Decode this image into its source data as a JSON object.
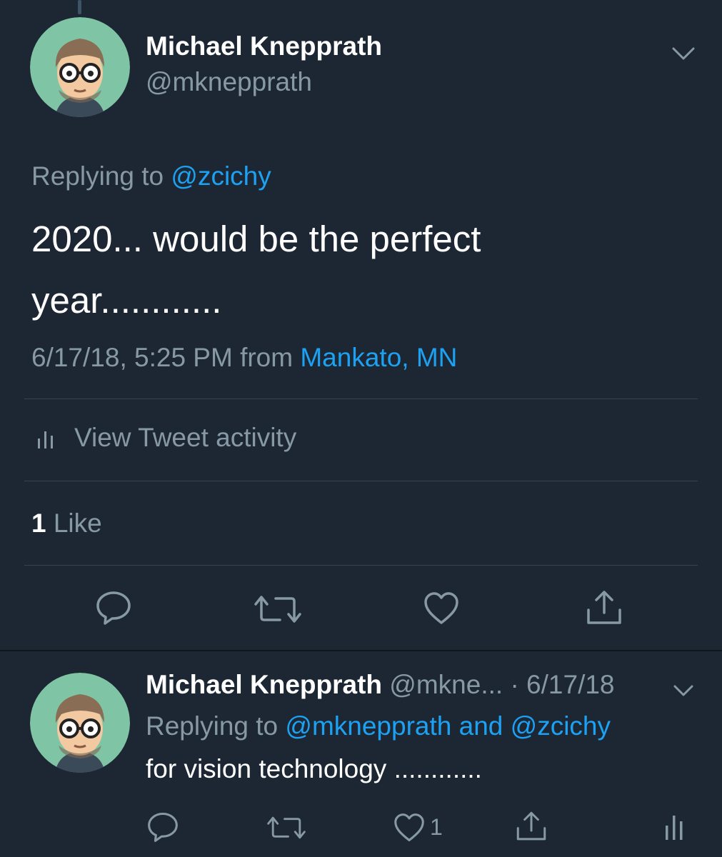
{
  "main_tweet": {
    "author_name": "Michael Knepprath",
    "author_handle": "@mknepprath",
    "replying_prefix": "Replying to ",
    "replying_to": "@zcichy",
    "text_line1": "2020... would be the perfect",
    "text_line2": "year............",
    "timestamp": "6/17/18, 5:25 PM from ",
    "location": "Mankato, MN",
    "activity_label": "View Tweet activity",
    "likes_count": "1",
    "likes_label": " Like"
  },
  "reply_tweet": {
    "author_name": "Michael Knepprath",
    "author_handle": "@mkne...",
    "date": "· 6/17/18",
    "replying_prefix": "Replying to ",
    "replying_to": "@mknepprath and @zcichy",
    "text": "for vision technology ............",
    "like_count": "1"
  },
  "colors": {
    "background": "#1c2733",
    "accent": "#1da1f2",
    "muted": "#8899a6",
    "avatar_bg": "#7fc4a4"
  },
  "icons": [
    "chevron-down-icon",
    "activity-icon",
    "reply-icon",
    "retweet-icon",
    "like-icon",
    "share-icon",
    "analytics-icon"
  ]
}
